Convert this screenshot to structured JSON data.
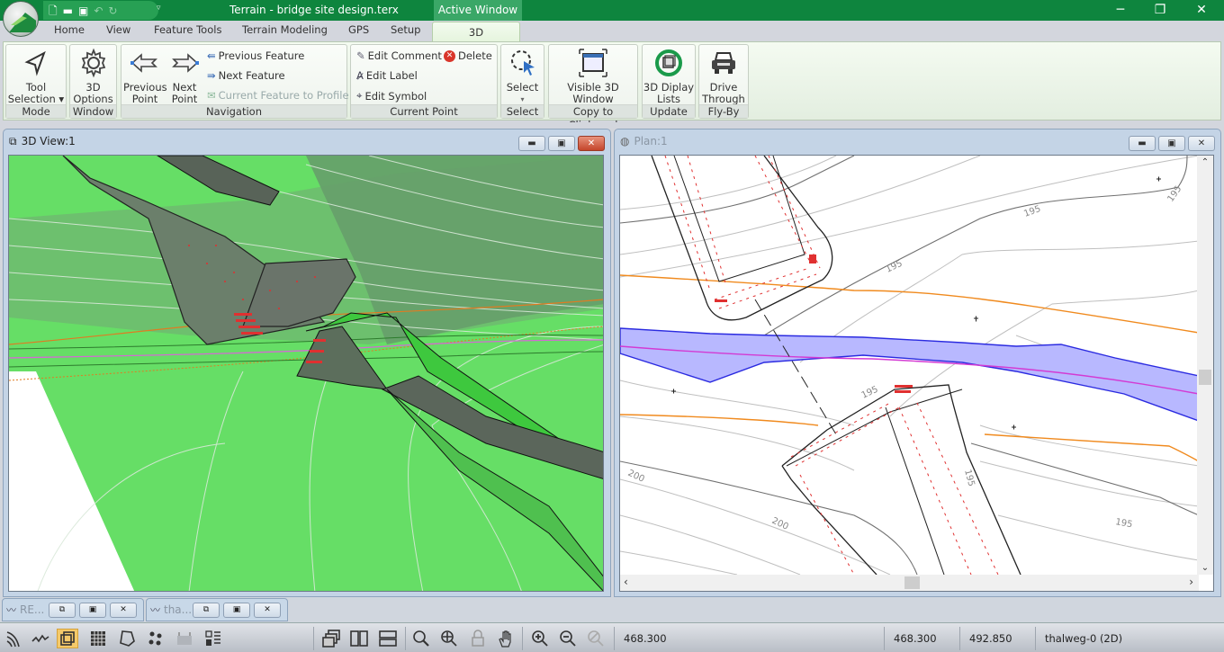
{
  "titlebar": {
    "title": "Terrain - bridge site design.terx",
    "context_tab": "Active Window",
    "quick_access": [
      "new-file-icon",
      "open-folder-icon",
      "save-icon",
      "undo-icon",
      "redo-icon"
    ],
    "controls": {
      "minimize": "─",
      "restore": "❐",
      "close": "✕"
    },
    "brand_color": "#0e853e"
  },
  "ribbon_tabs": [
    {
      "label": "Home"
    },
    {
      "label": "View"
    },
    {
      "label": "Feature Tools"
    },
    {
      "label": "Terrain Modeling"
    },
    {
      "label": "GPS"
    },
    {
      "label": "Setup"
    },
    {
      "label": "3D",
      "active": true
    }
  ],
  "ribbon": {
    "mode": {
      "label": "Mode",
      "tool_selection": [
        "Tool",
        "Selection ▾"
      ]
    },
    "window": {
      "label": "Window",
      "options": [
        "3D",
        "Options"
      ]
    },
    "navigation": {
      "label": "Navigation",
      "previous_point": [
        "Previous",
        "Point"
      ],
      "next_point": [
        "Next",
        "Point"
      ],
      "previous_feature": "Previous Feature",
      "next_feature": "Next Feature",
      "current_feature_to_profile": "Current Feature to Profile"
    },
    "current_point": {
      "label": "Current Point",
      "edit_comment": "Edit Comment",
      "delete": "Delete",
      "edit_label": "Edit Label",
      "edit_symbol": "Edit Symbol"
    },
    "select": {
      "label": "Select",
      "select": "Select",
      "arrow": "▾"
    },
    "clipboard": {
      "label": "Copy to Clipboard",
      "visible_window": [
        "Visible 3D",
        "Window"
      ]
    },
    "update": {
      "label": "Update",
      "display_lists": [
        "3D Diplay",
        "Lists"
      ]
    },
    "flyby": {
      "label": "Fly-By",
      "drive_through": [
        "Drive",
        "Through"
      ]
    }
  },
  "windows": {
    "view3d": {
      "title": "3D View:1",
      "active": true
    },
    "plan": {
      "title": "Plan:1",
      "active": false,
      "contour_labels": [
        "195",
        "195",
        "195",
        "195",
        "200",
        "200",
        "195",
        "195"
      ]
    }
  },
  "minimized": [
    {
      "label": "RE..."
    },
    {
      "label": "tha..."
    }
  ],
  "status": {
    "value_1": "468.300",
    "value_2": "468.300",
    "value_3": "492.850",
    "feature": "thalweg-0 (2D)"
  }
}
